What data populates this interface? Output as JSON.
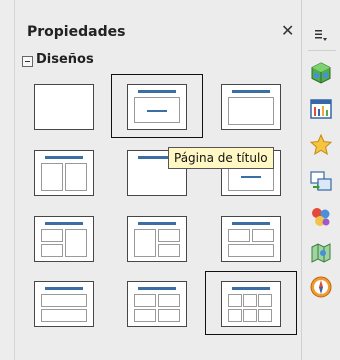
{
  "panel": {
    "title": "Propiedades",
    "close_glyph": "✕",
    "section": {
      "title": "Diseños",
      "collapsed": false
    },
    "tooltip": "Página de título"
  },
  "layouts": [
    {
      "type": "blank",
      "selected": false
    },
    {
      "type": "title-slide",
      "selected": true
    },
    {
      "type": "title-content",
      "selected": false
    },
    {
      "type": "title-2content",
      "selected": false
    },
    {
      "type": "title-only",
      "selected": false
    },
    {
      "type": "centered-text",
      "selected": false
    },
    {
      "type": "title-2content-content",
      "selected": false
    },
    {
      "type": "title-content-2content",
      "selected": false
    },
    {
      "type": "title-2content-over-content",
      "selected": false
    },
    {
      "type": "title-content-over-content",
      "selected": false
    },
    {
      "type": "title-4content",
      "selected": false
    },
    {
      "type": "title-6content",
      "selected": true
    }
  ],
  "sidebar": {
    "menu_icon": "sidebar-menu-icon",
    "buttons": [
      {
        "name": "properties-deck-icon",
        "active": true
      },
      {
        "name": "master-slides-deck-icon",
        "active": false
      },
      {
        "name": "custom-animation-deck-icon",
        "active": false
      },
      {
        "name": "slide-transition-deck-icon",
        "active": false
      },
      {
        "name": "gallery-deck-icon",
        "active": false
      },
      {
        "name": "navigator-deck-icon",
        "active": false
      },
      {
        "name": "styles-deck-icon",
        "active": false
      }
    ]
  }
}
